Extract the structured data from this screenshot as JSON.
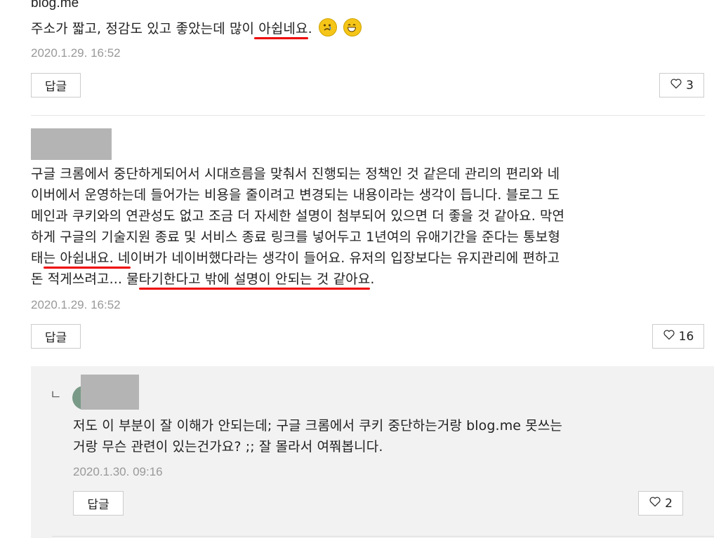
{
  "comments": [
    {
      "cut_top_text": "blog.me",
      "text_before_u": "주소가 짧고, 정감도 있고 좋았는데 많이",
      "underlined": " 아쉽네요",
      "text_after_u": ".",
      "emojis": [
        "sad-face-icon",
        "grinning-face-icon"
      ],
      "date": "2020.1.29. 16:52",
      "reply_label": "답글",
      "likes": "3"
    },
    {
      "lines": [
        "구글 크롬에서 중단하게되어서 시대흐름을 맞춰서 진행되는 정책인 것 같은데 관리의 편리와 네",
        "이버에서 운영하는데 들어가는 비용을 줄이려고 변경되는 내용이라는 생각이 듭니다. 블로그 도",
        "메인과 쿠키와의 연관성도 없고 조금 더 자세한 설명이 첨부되어 있으면 더 좋을 것 같아요. 막연",
        "하게 구글의 기술지원 종료 및 서비스 종료 링크를 넣어두고 1년여의 유애기간을 준다는 통보형"
      ],
      "line5_pre": "태",
      "line5_u": "는 아쉽내요. 네",
      "line5_post": "이버가 네이버했다라는 생각이 들어요. 유저의 입장보다는 유지관리에 편하고",
      "line6_pre": "돈 적게쓰려고... 물",
      "line6_u": "타기한다고 밖에 설명이 안되는 것 같아요",
      "line6_post": ".",
      "date": "2020.1.29. 16:52",
      "reply_label": "답글",
      "likes": "16"
    }
  ],
  "reply": {
    "reply_arrow": "ㄴ",
    "lines": [
      "저도 이 부분이 잘 이해가 안되는데; 구글 크롬에서 쿠키 중단하는거랑 blog.me 못쓰는",
      "거랑 무슨 관련이 있는건가요? ;; 잘 몰라서 여쭤봅니다."
    ],
    "date": "2020.1.30. 09:16",
    "reply_label": "답글",
    "likes": "2"
  },
  "colors": {
    "underline": "#e00000",
    "reply_bg": "#f2f2f2",
    "avatar_blur": "#b4b4b4"
  }
}
